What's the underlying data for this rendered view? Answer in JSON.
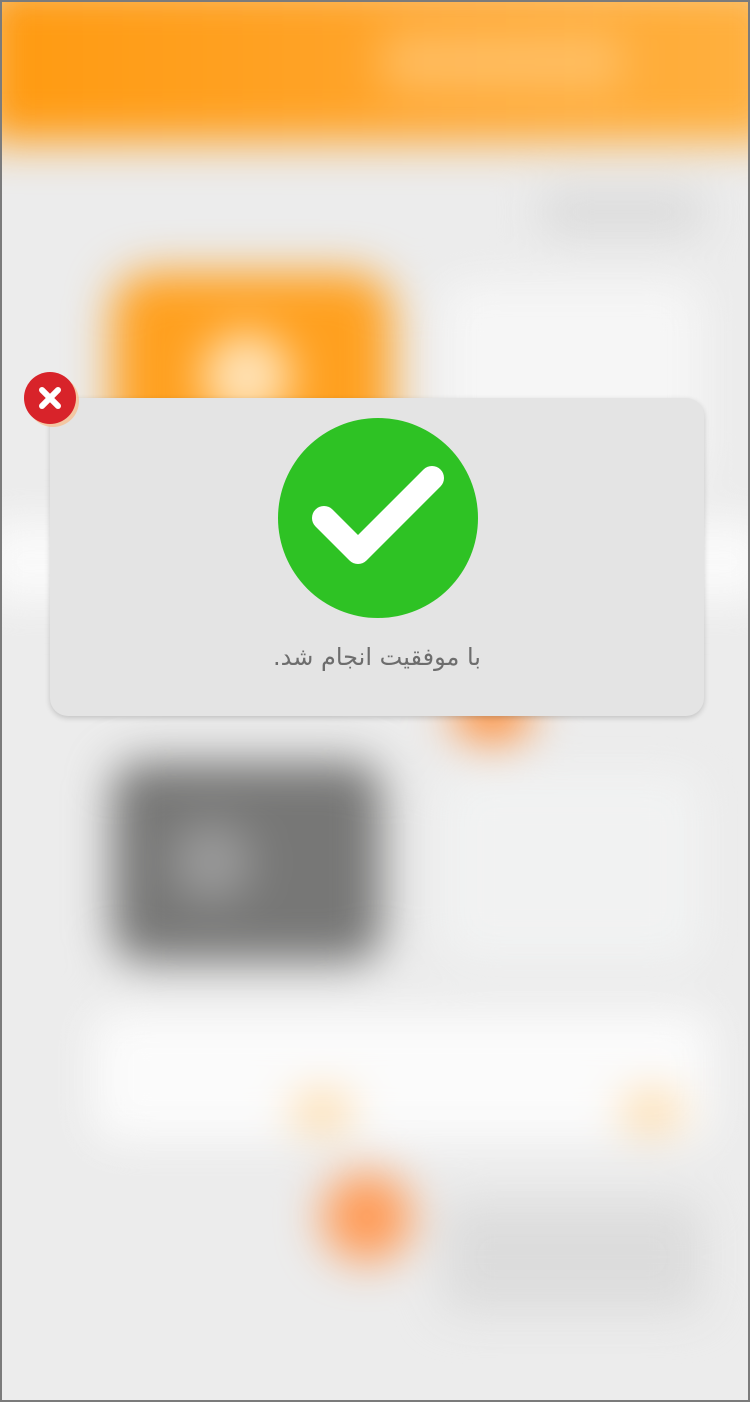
{
  "dialog": {
    "message": "با موفقیت انجام شد.",
    "status_icon": "check-circle-icon",
    "status_color": "#2ec224"
  },
  "close_button": {
    "icon": "close-icon",
    "color": "#d8232a"
  },
  "background": {
    "accent_color": "#ff9a10",
    "blurred": true
  }
}
